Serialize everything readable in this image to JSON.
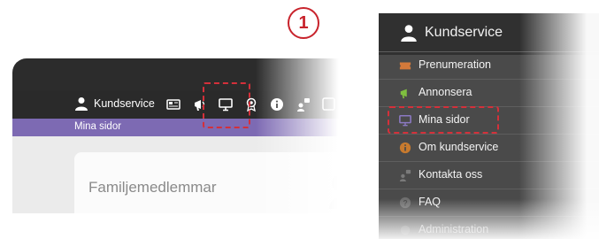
{
  "step_number": "1",
  "colors": {
    "accent_purple": "#7d6ab3",
    "highlight_red": "#d4303a",
    "toolbar_dark": "#2a2a2a",
    "menu_dark": "#4a4a4a"
  },
  "toolbar": {
    "user_label": "Kundservice",
    "icons": [
      "user-icon",
      "newspaper-icon",
      "megaphone-icon",
      "monitor-icon",
      "award-icon",
      "info-icon",
      "contact-icon",
      "faq-icon"
    ],
    "selected_icon": "monitor-icon"
  },
  "breadcrumb": "Mina sidor",
  "main": {
    "card_title": "Familjemedlemmar"
  },
  "menu": {
    "title": "Kundservice",
    "items": [
      {
        "label": "Prenumeration",
        "icon": "ticket-icon"
      },
      {
        "label": "Annonsera",
        "icon": "megaphone-icon"
      },
      {
        "label": "Mina sidor",
        "icon": "monitor-icon",
        "highlighted": true
      },
      {
        "label": "Om kundservice",
        "icon": "info-icon"
      },
      {
        "label": "Kontakta oss",
        "icon": "contact-icon"
      },
      {
        "label": "FAQ",
        "icon": "question-icon"
      },
      {
        "label": "Administration",
        "icon": "admin-icon"
      }
    ]
  }
}
